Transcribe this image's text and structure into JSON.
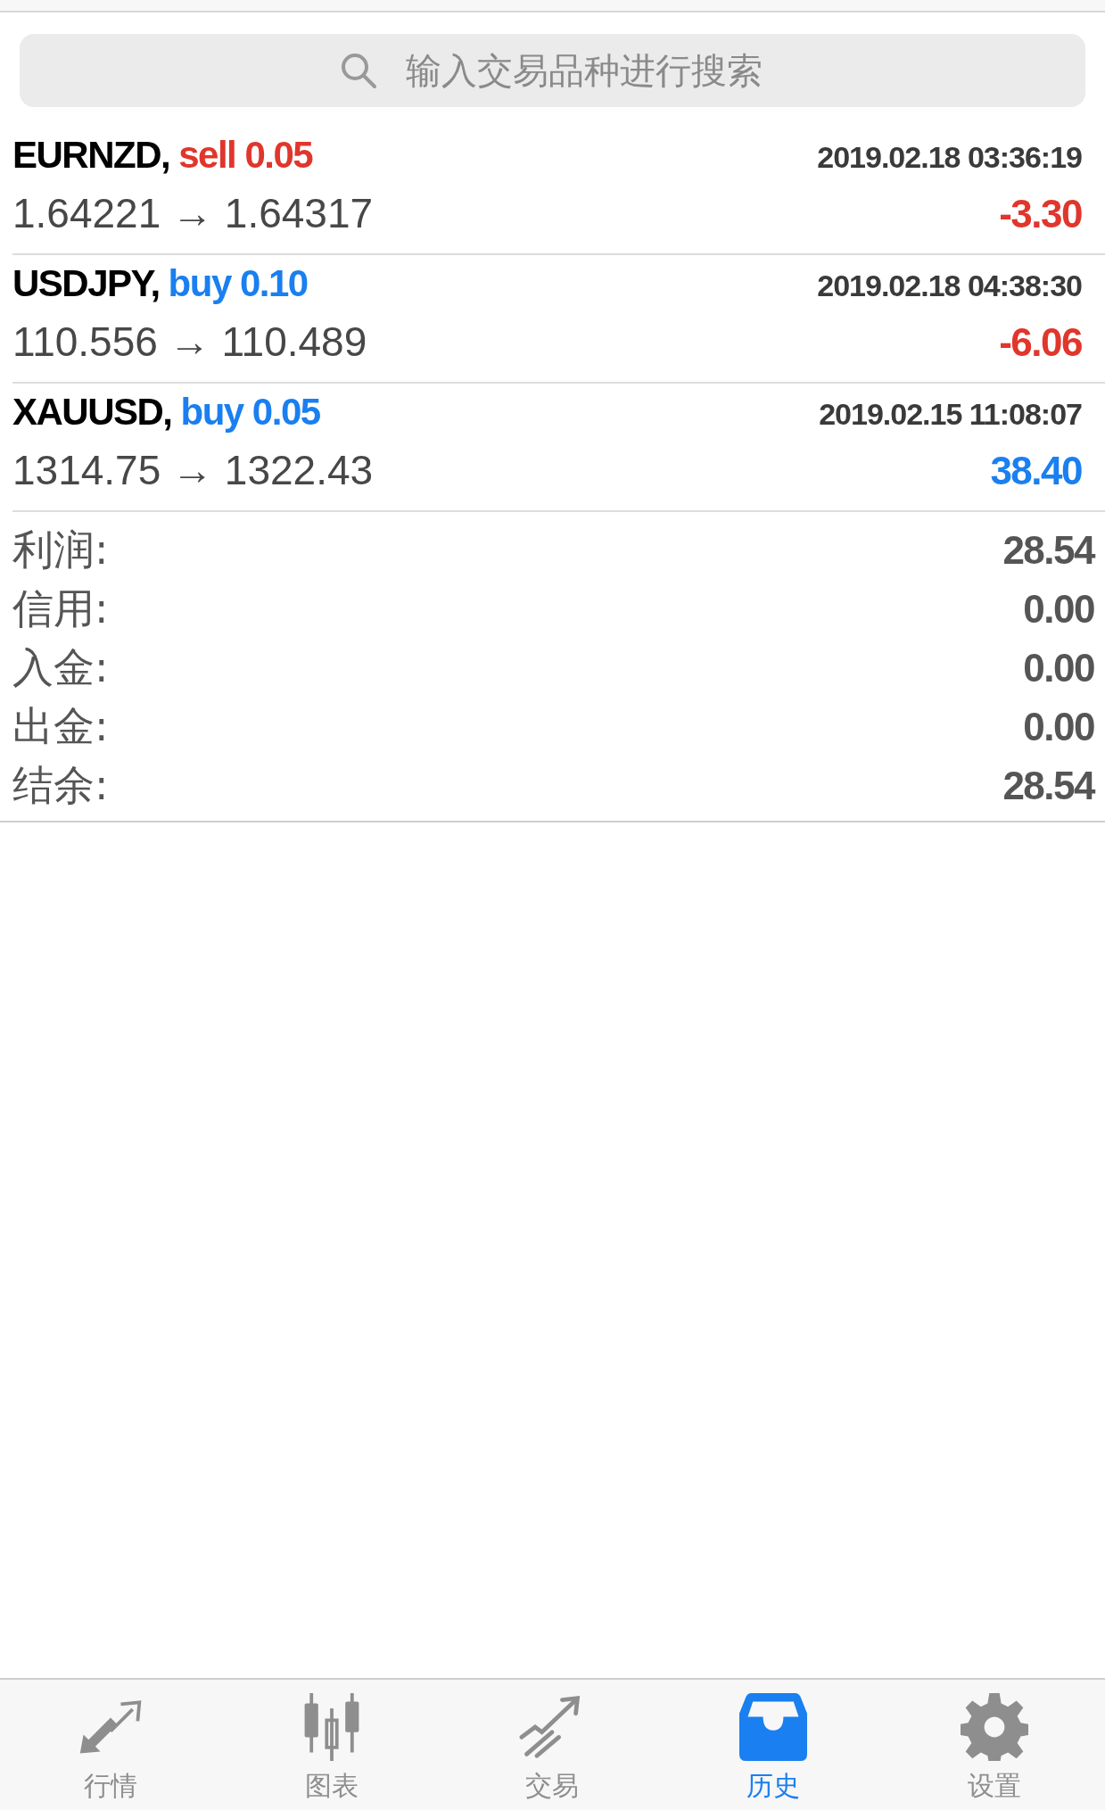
{
  "search": {
    "placeholder": "输入交易品种进行搜索"
  },
  "trades": [
    {
      "symbol": "EURNZD,",
      "order": {
        "text": "sell 0.05",
        "kind": "sell"
      },
      "time": "2019.02.18 03:36:19",
      "prices": "1.64221 → 1.64317",
      "profit": {
        "text": "-3.30",
        "kind": "loss"
      }
    },
    {
      "symbol": "USDJPY,",
      "order": {
        "text": "buy 0.10",
        "kind": "buy"
      },
      "time": "2019.02.18 04:38:30",
      "prices": "110.556 → 110.489",
      "profit": {
        "text": "-6.06",
        "kind": "loss"
      }
    },
    {
      "symbol": "XAUUSD,",
      "order": {
        "text": "buy 0.05",
        "kind": "buy"
      },
      "time": "2019.02.15 11:08:07",
      "prices": "1314.75 → 1322.43",
      "profit": {
        "text": "38.40",
        "kind": "gain"
      }
    }
  ],
  "summary": [
    {
      "label": "利润:",
      "value": "28.54"
    },
    {
      "label": "信用:",
      "value": "0.00"
    },
    {
      "label": "入金:",
      "value": "0.00"
    },
    {
      "label": "出金:",
      "value": "0.00"
    },
    {
      "label": "结余:",
      "value": "28.54"
    }
  ],
  "tabs": [
    {
      "label": "行情",
      "kind": "quotes",
      "selected": false
    },
    {
      "label": "图表",
      "kind": "chart",
      "selected": false
    },
    {
      "label": "交易",
      "kind": "trade",
      "selected": false
    },
    {
      "label": "历史",
      "kind": "history",
      "selected": true
    },
    {
      "label": "设置",
      "kind": "settings",
      "selected": false
    }
  ]
}
